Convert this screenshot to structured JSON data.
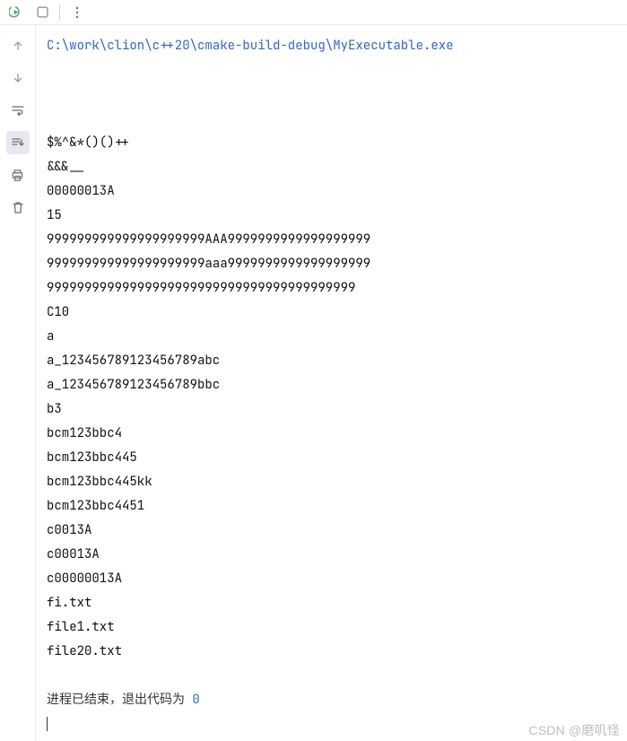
{
  "toolbar": {
    "rerun": "rerun",
    "stop": "stop",
    "more": "more"
  },
  "gutter": {
    "up": "up",
    "down": "down",
    "softwrap": "soft-wrap",
    "scrollend": "scroll-to-end",
    "print": "print",
    "clear": "clear"
  },
  "console": {
    "path": "C:\\work\\clion\\c++20\\cmake-build-debug\\MyExecutable.exe",
    "lines": [
      "",
      "",
      "",
      "$%^&*()()++",
      "&&&__",
      "00000013A",
      "15",
      "999999999999999999999AAA9999999999999999999",
      "999999999999999999999aaa9999999999999999999",
      "99999999999999999999999999999999999999999",
      "C10",
      "a",
      "a_123456789123456789abc",
      "a_123456789123456789bbc",
      "b3",
      "bcm123bbc4",
      "bcm123bbc445",
      "bcm123bbc445kk",
      "bcm123bbc4451",
      "c0013A",
      "c00013A",
      "c00000013A",
      "fi.txt",
      "file1.txt",
      "file20.txt",
      ""
    ],
    "exit_text": "进程已结束，退出代码为 ",
    "exit_code": "0"
  },
  "watermark": "CSDN @磨叽怪"
}
